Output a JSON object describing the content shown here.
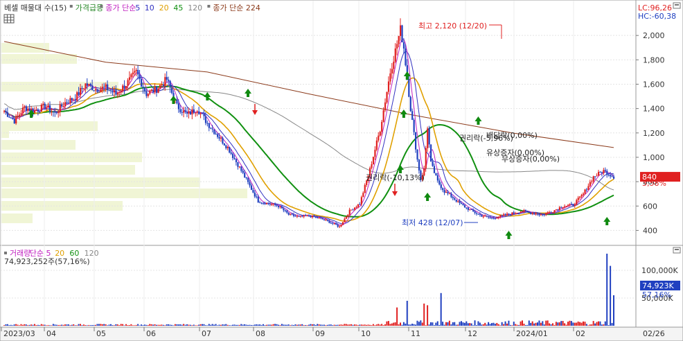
{
  "main_legend": [
    {
      "text": "베셀 매물대 수(15)",
      "color": "#333333"
    },
    {
      "text": "가격급등",
      "color": "#2a8a2a"
    },
    {
      "text": "종가 단순",
      "color": "#c020c0"
    },
    {
      "text": "5",
      "color": "#3030c0"
    },
    {
      "text": "10",
      "color": "#3030c0"
    },
    {
      "text": "20",
      "color": "#e0a000"
    },
    {
      "text": "45",
      "color": "#109010"
    },
    {
      "text": "120",
      "color": "#888888"
    },
    {
      "text": "종가 단순 224",
      "color": "#8b3a1a"
    }
  ],
  "vol_legend": [
    {
      "text": "거래량",
      "color": "#c020c0"
    },
    {
      "text": "단순 5",
      "color": "#c020c0"
    },
    {
      "text": "20",
      "color": "#e0a000"
    },
    {
      "text": "60",
      "color": "#109010"
    },
    {
      "text": "120",
      "color": "#888888"
    }
  ],
  "vol_value": "74,923,252주(57,16%)",
  "lc_label": "LC:96,26",
  "hc_label": "HC:-60,38",
  "price_badge": "840",
  "price_change": "3,58%",
  "vol_badge": "74,923K",
  "vol_pct": "57,16%",
  "annotations": {
    "high": "최고 2,120 (12/20)",
    "low": "최저 428 (12/07)",
    "rights_down": "권리락(-10,13%)",
    "rights_mid": "권리락(-5,96%)",
    "rights_high": "배당락(0,00%)",
    "paid_in": "유상증자(0,00%)",
    "free_in": "무상증자(0,00%)"
  },
  "colors": {
    "up": "#e02020",
    "down": "#2040c0",
    "ma5": "#c020c0",
    "ma10": "#3030c0",
    "ma20": "#e0a000",
    "ma45": "#109010",
    "ma120": "#888888",
    "ma224": "#8b3a1a",
    "profile": "#f0f5d5"
  },
  "chart_data": {
    "type": "candlestick",
    "x_ticks": [
      "2023/03",
      "04",
      "05",
      "06",
      "07",
      "08",
      "09",
      "10",
      "11",
      "12",
      "2024/01",
      "02"
    ],
    "x_end_label": "02/26",
    "y_ticks": [
      400,
      600,
      800,
      1000,
      1200,
      1400,
      1600,
      1800,
      2000
    ],
    "ylim": [
      300,
      2200
    ],
    "vol_ticks": [
      "100,000K",
      "50,000K"
    ],
    "vol_ylim": [
      0,
      135000
    ],
    "high": {
      "value": 2120,
      "date": "12/20"
    },
    "low": {
      "value": 428,
      "date": "12/07"
    },
    "last_close": 840,
    "series": [
      {
        "name": "close",
        "x": [
          0,
          6,
          12,
          18,
          24,
          30,
          36,
          42,
          48,
          54,
          60,
          66,
          72,
          78,
          84,
          90,
          96,
          102,
          108,
          114,
          120,
          126,
          132,
          138,
          144,
          150,
          156,
          162,
          168,
          174,
          180,
          186,
          192,
          198,
          204,
          210,
          216,
          222,
          228,
          234,
          236,
          240,
          244,
          246,
          248,
          250,
          252,
          256,
          260,
          264,
          270,
          276,
          282,
          288,
          294,
          300,
          306,
          312,
          318,
          324,
          330,
          336,
          342,
          348,
          354,
          360
        ],
        "y": [
          1380,
          1300,
          1410,
          1380,
          1420,
          1360,
          1450,
          1490,
          1600,
          1560,
          1570,
          1520,
          1600,
          1700,
          1520,
          1560,
          1640,
          1420,
          1350,
          1400,
          1280,
          1180,
          1080,
          940,
          790,
          640,
          620,
          600,
          530,
          510,
          520,
          500,
          470,
          430,
          560,
          620,
          900,
          1230,
          1700,
          2050,
          1900,
          1400,
          980,
          820,
          900,
          1250,
          950,
          800,
          720,
          680,
          610,
          560,
          520,
          500,
          520,
          540,
          560,
          540,
          530,
          560,
          600,
          610,
          700,
          840,
          890,
          840
        ]
      },
      {
        "name": "ma224",
        "x": [
          0,
          60,
          120,
          180,
          240,
          300,
          360
        ],
        "y": [
          1950,
          1780,
          1700,
          1520,
          1350,
          1200,
          1080
        ]
      }
    ],
    "volume_spikes": [
      {
        "x": 232,
        "value": 33000
      },
      {
        "x": 238,
        "value": 45000
      },
      {
        "x": 248,
        "value": 40000
      },
      {
        "x": 250,
        "value": 37000
      },
      {
        "x": 258,
        "value": 59000
      },
      {
        "x": 356,
        "value": 130000
      },
      {
        "x": 358,
        "value": 108000
      },
      {
        "x": 360,
        "value": 55000
      }
    ]
  }
}
